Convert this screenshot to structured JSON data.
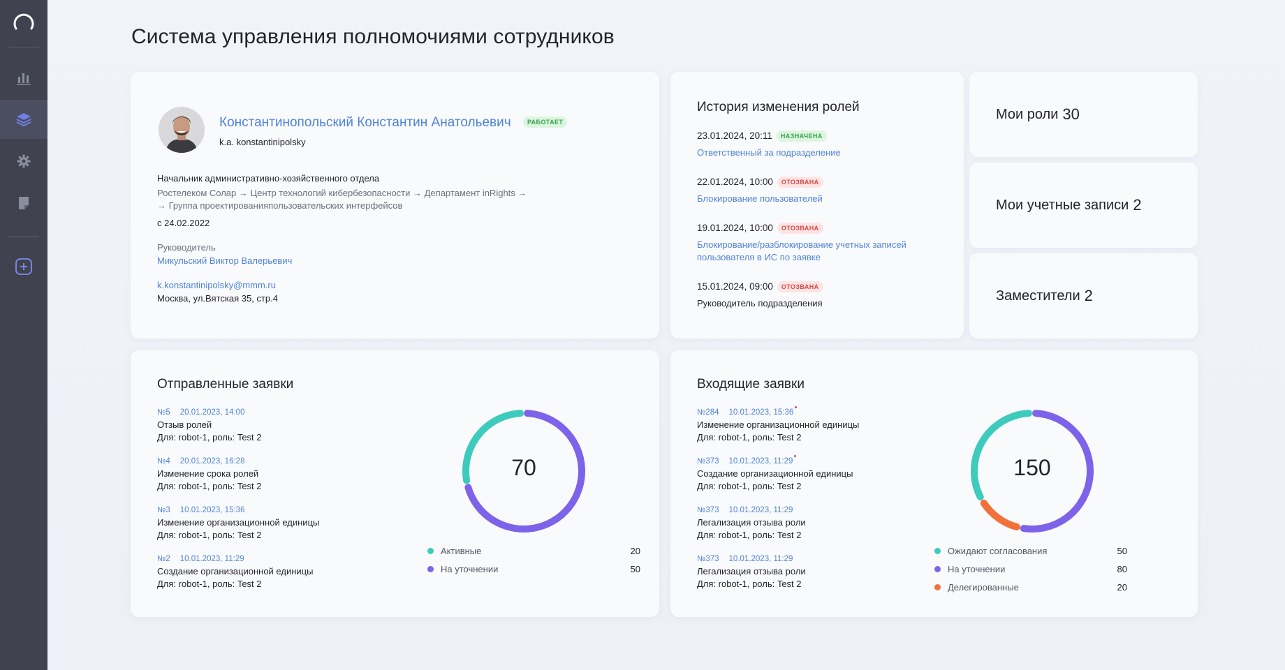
{
  "page_title": "Система управления полномочиями сотрудников",
  "profile": {
    "name": "Константинопольский Константин Анатольевич",
    "status": "РАБОТАЕТ",
    "login": "k.a. konstantinipolsky",
    "position": "Начальник административно-хозяйственного отдела",
    "path_line1": "Ростелеком Солар  → Центр технологий кибербезопасности → Департамент inRights →",
    "path_line2": "→ Группа проектированияпользовательских интерфейсов",
    "since": "с 24.02.2022",
    "manager_label": "Руководитель",
    "manager_name": "Микульский Виктор Валерьевич",
    "email": "k.konstantinipolsky@mmm.ru",
    "address": "Москва, ул.Вятская 35, стр.4"
  },
  "history": {
    "title": "История изменения ролей",
    "items": [
      {
        "date": "23.01.2024, 20:11",
        "badge": "НАЗНАЧЕНА",
        "desc": "Ответственный за подразделение"
      },
      {
        "date": "22.01.2024, 10:00",
        "badge": "ОТОЗВАНА",
        "desc": "Блокирование пользователей"
      },
      {
        "date": "19.01.2024, 10:00",
        "badge": "ОТОЗВАНА",
        "desc_line1": "Блокирование/разблокирование учетных записей",
        "desc_line2": "пользователя в ИС по заявке"
      },
      {
        "date": "15.01.2024, 09:00",
        "badge": "ОТОЗВАНА",
        "desc": "Руководитель подразделения"
      }
    ]
  },
  "stats": {
    "roles_label": "Мои роли",
    "roles_value": "30",
    "accounts_label": "Мои учетные записи",
    "accounts_value": "2",
    "deputies_label": "Заместители",
    "deputies_value": "2"
  },
  "sent": {
    "title": "Отправленные заявки",
    "requests": [
      {
        "num": "№5",
        "date": "20.01.2023,  14:00",
        "title": "Отзыв ролей",
        "sub": "Для: robot-1, роль: Test 2"
      },
      {
        "num": "№4",
        "date": "20.01.2023,  16:28",
        "title": "Изменение срока ролей",
        "sub": "Для: robot-1, роль: Test 2"
      },
      {
        "num": "№3",
        "date": "10.01.2023,  15:36",
        "title": "Изменение организационной единицы",
        "sub": "Для: robot-1, роль: Test 2"
      },
      {
        "num": "№2",
        "date": "10.01.2023,  11:29",
        "title": "Создание организационной единицы",
        "sub": "Для: robot-1, роль: Test 2"
      }
    ],
    "total": "70",
    "legend": [
      {
        "label": "Активные",
        "value": "20",
        "color": "#3ccbbd"
      },
      {
        "label": "На уточнении",
        "value": "50",
        "color": "#7d63ea"
      }
    ]
  },
  "incoming": {
    "title": "Входящие заявки",
    "requests": [
      {
        "num": "№284",
        "date": "10.01.2023,  15:36",
        "title": "Изменение организационной единицы",
        "sub": "Для: robot-1, роль: Test 2"
      },
      {
        "num": "№373",
        "date": "10.01.2023,  11:29",
        "title": "Создание организационной единицы",
        "sub": "Для: robot-1, роль: Test 2"
      },
      {
        "num": "№373",
        "date": "10.01.2023,  11:29",
        "title": "Легализация отзыва роли",
        "sub": "Для: robot-1, роль: Test 2"
      },
      {
        "num": "№373",
        "date": "10.01.2023,  11:29",
        "title": "Легализация отзыва роли",
        "sub": "Для: robot-1, роль: Test 2"
      }
    ],
    "total": "150",
    "legend": [
      {
        "label": "Ожидают согласования",
        "value": "50",
        "color": "#3ccbbd"
      },
      {
        "label": "На уточнении",
        "value": "80",
        "color": "#7d63ea"
      },
      {
        "label": "Делегированные",
        "value": "20",
        "color": "#f2703a"
      }
    ]
  },
  "colors": {
    "accent": "#4f83d8",
    "sidebar": "#40424f",
    "teal": "#3ccbbd",
    "violet": "#7d63ea",
    "orange": "#f2703a"
  }
}
